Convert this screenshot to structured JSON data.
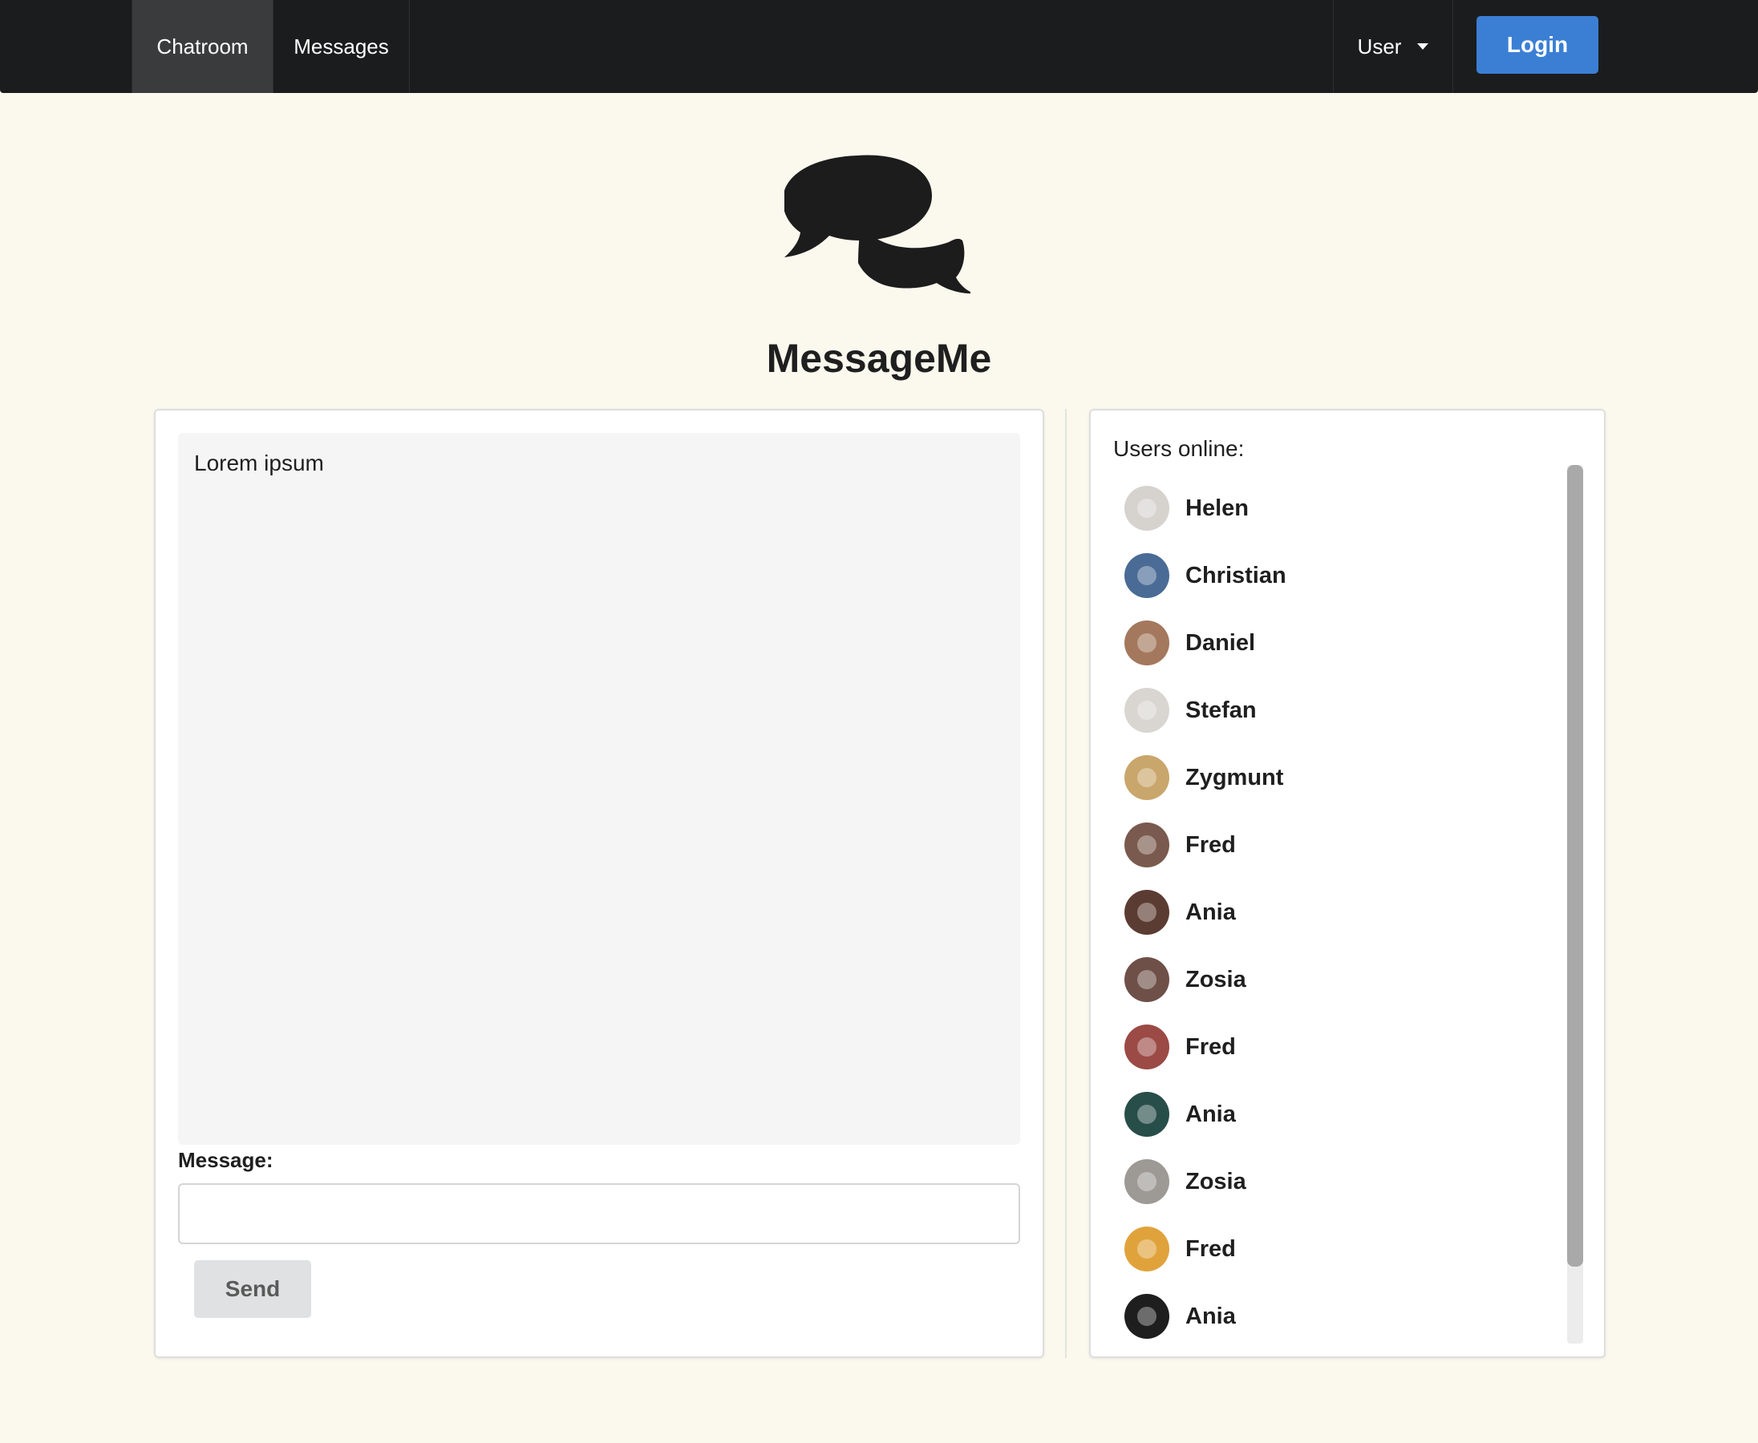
{
  "nav": {
    "chatroom_label": "Chatroom",
    "messages_label": "Messages",
    "user_label": "User",
    "login_label": "Login",
    "colors": {
      "background": "#1b1c1d",
      "active_item": "#3a3b3c",
      "login": "#3b7fd4"
    }
  },
  "header": {
    "logo_icon": "comments-icon",
    "title": "MessageMe"
  },
  "chat": {
    "messages": [
      "Lorem ipsum"
    ],
    "message_label": "Message:",
    "message_value": "",
    "send_label": "Send"
  },
  "users": {
    "heading": "Users online:",
    "list": [
      {
        "name": "Helen",
        "avatar_color": "#d6d3cf"
      },
      {
        "name": "Christian",
        "avatar_color": "#4a6b95"
      },
      {
        "name": "Daniel",
        "avatar_color": "#a4785c"
      },
      {
        "name": "Stefan",
        "avatar_color": "#d9d6d1"
      },
      {
        "name": "Zygmunt",
        "avatar_color": "#c9a66b"
      },
      {
        "name": "Fred",
        "avatar_color": "#7a5a4e"
      },
      {
        "name": "Ania",
        "avatar_color": "#5b3c32"
      },
      {
        "name": "Zosia",
        "avatar_color": "#6e5048"
      },
      {
        "name": "Fred",
        "avatar_color": "#9b4a45"
      },
      {
        "name": "Ania",
        "avatar_color": "#284e4a"
      },
      {
        "name": "Zosia",
        "avatar_color": "#9d9a96"
      },
      {
        "name": "Fred",
        "avatar_color": "#e0a33c"
      },
      {
        "name": "Ania",
        "avatar_color": "#1e1e1e"
      }
    ]
  },
  "page_background": "#fbf9ee"
}
